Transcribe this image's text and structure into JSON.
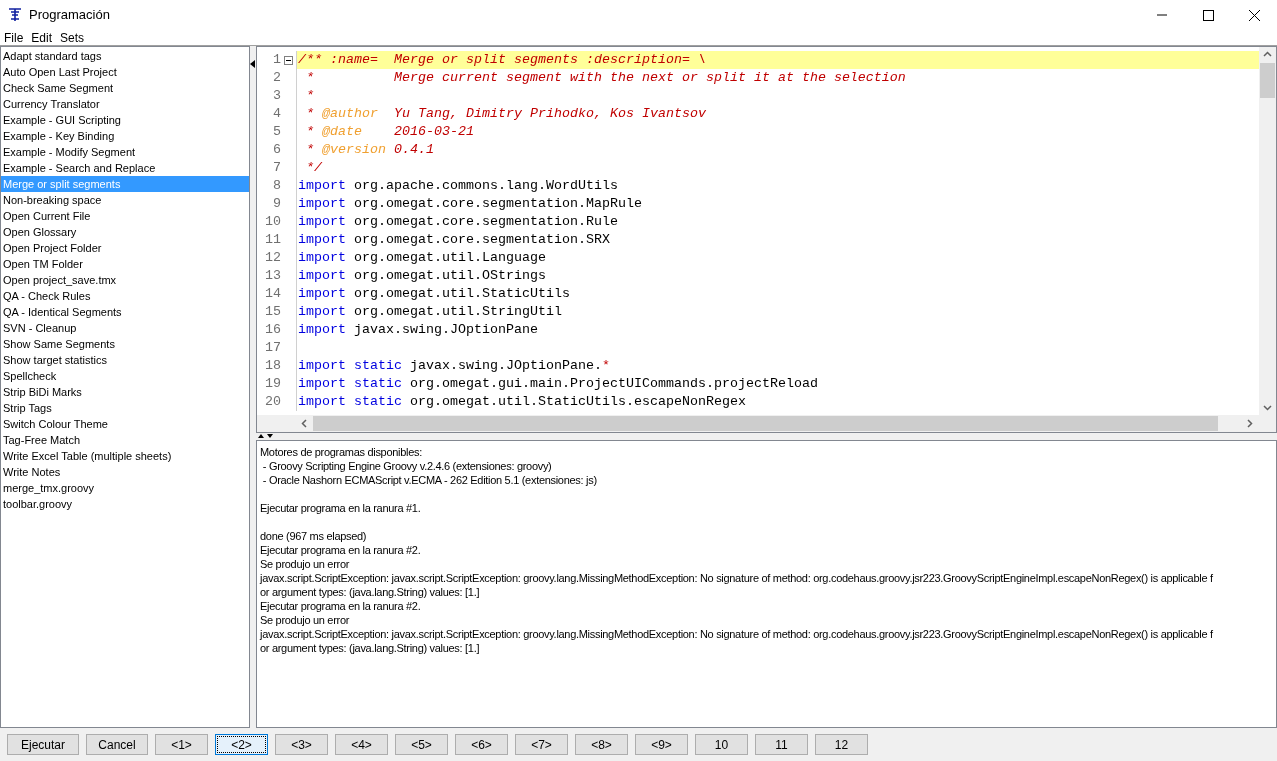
{
  "window": {
    "title": "Programación"
  },
  "menu": [
    "File",
    "Edit",
    "Sets"
  ],
  "scripts": [
    {
      "label": "Adapt standard tags",
      "selected": false
    },
    {
      "label": "Auto Open Last Project",
      "selected": false
    },
    {
      "label": "Check Same Segment",
      "selected": false
    },
    {
      "label": "Currency Translator",
      "selected": false
    },
    {
      "label": "Example - GUI Scripting",
      "selected": false
    },
    {
      "label": "Example - Key Binding",
      "selected": false
    },
    {
      "label": "Example - Modify Segment",
      "selected": false
    },
    {
      "label": "Example - Search and Replace",
      "selected": false
    },
    {
      "label": "Merge or split segments",
      "selected": true
    },
    {
      "label": "Non-breaking space",
      "selected": false
    },
    {
      "label": "Open Current File",
      "selected": false
    },
    {
      "label": "Open Glossary",
      "selected": false
    },
    {
      "label": "Open Project Folder",
      "selected": false
    },
    {
      "label": "Open TM Folder",
      "selected": false
    },
    {
      "label": "Open project_save.tmx",
      "selected": false
    },
    {
      "label": "QA - Check Rules",
      "selected": false
    },
    {
      "label": "QA - Identical Segments",
      "selected": false
    },
    {
      "label": "SVN - Cleanup",
      "selected": false
    },
    {
      "label": "Show Same Segments",
      "selected": false
    },
    {
      "label": "Show target statistics",
      "selected": false
    },
    {
      "label": "Spellcheck",
      "selected": false
    },
    {
      "label": "Strip BiDi Marks",
      "selected": false
    },
    {
      "label": "Strip Tags",
      "selected": false
    },
    {
      "label": "Switch Colour Theme",
      "selected": false
    },
    {
      "label": "Tag-Free Match",
      "selected": false
    },
    {
      "label": "Write Excel Table (multiple sheets)",
      "selected": false
    },
    {
      "label": "Write Notes",
      "selected": false
    },
    {
      "label": "merge_tmx.groovy",
      "selected": false
    },
    {
      "label": "toolbar.groovy",
      "selected": false
    }
  ],
  "editor": {
    "lines": [
      {
        "number": "1",
        "current": true,
        "segments": [
          {
            "kind": "comment",
            "text": "/** :name=  Merge or split segments :description= \\"
          }
        ]
      },
      {
        "number": "2",
        "current": false,
        "segments": [
          {
            "kind": "comment",
            "text": " *          Merge current segment with the next or split it at the selection"
          }
        ]
      },
      {
        "number": "3",
        "current": false,
        "segments": [
          {
            "kind": "comment",
            "text": " *"
          }
        ]
      },
      {
        "number": "4",
        "current": false,
        "segments": [
          {
            "kind": "comment",
            "text": " * "
          },
          {
            "kind": "tag",
            "text": "@author"
          },
          {
            "kind": "comment",
            "text": "  Yu Tang, Dimitry Prihodko, Kos Ivantsov"
          }
        ]
      },
      {
        "number": "5",
        "current": false,
        "segments": [
          {
            "kind": "comment",
            "text": " * "
          },
          {
            "kind": "tag",
            "text": "@date"
          },
          {
            "kind": "comment",
            "text": "    2016-03-21"
          }
        ]
      },
      {
        "number": "6",
        "current": false,
        "segments": [
          {
            "kind": "comment",
            "text": " * "
          },
          {
            "kind": "tag",
            "text": "@version"
          },
          {
            "kind": "comment",
            "text": " 0.4.1"
          }
        ]
      },
      {
        "number": "7",
        "current": false,
        "segments": [
          {
            "kind": "comment",
            "text": " */"
          }
        ]
      },
      {
        "number": "8",
        "current": false,
        "segments": [
          {
            "kind": "keyword",
            "text": "import"
          },
          {
            "kind": "plain",
            "text": " org.apache.commons.lang.WordUtils"
          }
        ]
      },
      {
        "number": "9",
        "current": false,
        "segments": [
          {
            "kind": "keyword",
            "text": "import"
          },
          {
            "kind": "plain",
            "text": " org.omegat.core.segmentation.MapRule"
          }
        ]
      },
      {
        "number": "10",
        "current": false,
        "segments": [
          {
            "kind": "keyword",
            "text": "import"
          },
          {
            "kind": "plain",
            "text": " org.omegat.core.segmentation.Rule"
          }
        ]
      },
      {
        "number": "11",
        "current": false,
        "segments": [
          {
            "kind": "keyword",
            "text": "import"
          },
          {
            "kind": "plain",
            "text": " org.omegat.core.segmentation.SRX"
          }
        ]
      },
      {
        "number": "12",
        "current": false,
        "segments": [
          {
            "kind": "keyword",
            "text": "import"
          },
          {
            "kind": "plain",
            "text": " org.omegat.util.Language"
          }
        ]
      },
      {
        "number": "13",
        "current": false,
        "segments": [
          {
            "kind": "keyword",
            "text": "import"
          },
          {
            "kind": "plain",
            "text": " org.omegat.util.OStrings"
          }
        ]
      },
      {
        "number": "14",
        "current": false,
        "segments": [
          {
            "kind": "keyword",
            "text": "import"
          },
          {
            "kind": "plain",
            "text": " org.omegat.util.StaticUtils"
          }
        ]
      },
      {
        "number": "15",
        "current": false,
        "segments": [
          {
            "kind": "keyword",
            "text": "import"
          },
          {
            "kind": "plain",
            "text": " org.omegat.util.StringUtil"
          }
        ]
      },
      {
        "number": "16",
        "current": false,
        "segments": [
          {
            "kind": "keyword",
            "text": "import"
          },
          {
            "kind": "plain",
            "text": " javax.swing.JOptionPane"
          }
        ]
      },
      {
        "number": "17",
        "current": false
      },
      {
        "number": "18",
        "current": false,
        "segments": [
          {
            "kind": "keyword",
            "text": "import static"
          },
          {
            "kind": "plain",
            "text": " javax.swing.JOptionPane."
          },
          {
            "kind": "operator",
            "text": "*"
          }
        ]
      },
      {
        "number": "19",
        "current": false,
        "segments": [
          {
            "kind": "keyword",
            "text": "import static"
          },
          {
            "kind": "plain",
            "text": " org.omegat.gui.main.ProjectUICommands.projectReload"
          }
        ]
      },
      {
        "number": "20",
        "current": false,
        "segments": [
          {
            "kind": "keyword",
            "text": "import static"
          },
          {
            "kind": "plain",
            "text": " org.omegat.util.StaticUtils.escapeNonRegex"
          }
        ]
      }
    ]
  },
  "output": [
    [
      "Motores de programas disponibles:",
      " - Groovy Scripting Engine Groovy v.2.4.6 (extensiones: groovy)",
      " - Oracle Nashorn ECMAScript v.ECMA - 262 Edition 5.1 (extensiones: js)"
    ],
    [
      "Ejecutar programa en la ranura #1."
    ],
    [
      "done (967 ms elapsed)",
      "Ejecutar programa en la ranura #2.",
      "Se produjo un error",
      "javax.script.ScriptException: javax.script.ScriptException: groovy.lang.MissingMethodException: No signature of method: org.codehaus.groovy.jsr223.GroovyScriptEngineImpl.escapeNonRegex() is applicable f",
      "or argument types: (java.lang.String) values: [1.]",
      "Ejecutar programa en la ranura #2.",
      "Se produjo un error",
      "javax.script.ScriptException: javax.script.ScriptException: groovy.lang.MissingMethodException: No signature of method: org.codehaus.groovy.jsr223.GroovyScriptEngineImpl.escapeNonRegex() is applicable f",
      "or argument types: (java.lang.String) values: [1.]"
    ]
  ],
  "buttons": [
    {
      "label": "Ejecutar",
      "selected": false
    },
    {
      "label": "Cancel",
      "selected": false
    },
    {
      "label": "<1>",
      "selected": false
    },
    {
      "label": "<2>",
      "selected": true
    },
    {
      "label": "<3>",
      "selected": false
    },
    {
      "label": "<4>",
      "selected": false
    },
    {
      "label": "<5>",
      "selected": false
    },
    {
      "label": "<6>",
      "selected": false
    },
    {
      "label": "<7>",
      "selected": false
    },
    {
      "label": "<8>",
      "selected": false
    },
    {
      "label": "<9>",
      "selected": false
    },
    {
      "label": "10",
      "selected": false
    },
    {
      "label": "11",
      "selected": false
    },
    {
      "label": "12",
      "selected": false
    }
  ]
}
